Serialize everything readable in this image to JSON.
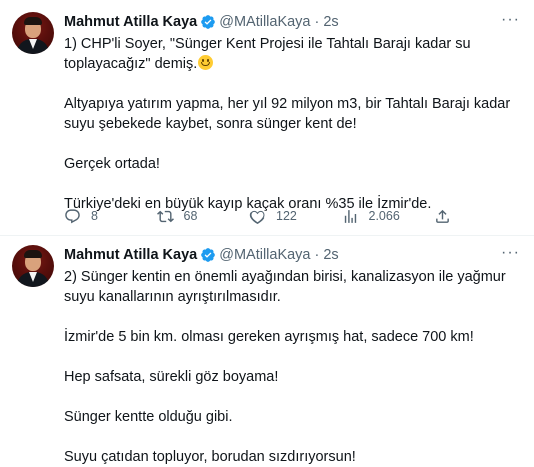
{
  "tweets": [
    {
      "author": "Mahmut Atilla Kaya",
      "handle": "@MAtillaKaya",
      "separator": "·",
      "time": "2s",
      "paragraphs": [
        "1) CHP'li Soyer, \"Sünger Kent Projesi ile Tahtalı Barajı kadar su toplayacağız\" demiş.",
        "Altyapıya yatırım yapma, her yıl 92 milyon m3, bir Tahtalı Barajı kadar suyu şebekede kaybet, sonra sünger kent de!",
        "Gerçek ortada!",
        "Türkiye'deki en büyük kayıp kaçak oranı %35 ile İzmir'de."
      ],
      "emoji": "grinning-face-emoji",
      "stats": {
        "replies": "8",
        "retweets": "68",
        "likes": "122",
        "views": "2.066"
      }
    },
    {
      "author": "Mahmut Atilla Kaya",
      "handle": "@MAtillaKaya",
      "separator": "·",
      "time": "2s",
      "paragraphs": [
        "2) Sünger kentin en önemli ayağından birisi, kanalizasyon ile yağmur suyu kanallarının ayrıştırılmasıdır.",
        "İzmir'de 5 bin km. olması gereken ayrışmış hat, sadece 700 km!",
        "Hep safsata, sürekli göz boyama!",
        "Sünger kentte olduğu gibi.",
        "Suyu çatıdan topluyor, borudan sızdırıyorsun!"
      ]
    }
  ],
  "more_label": "···",
  "colors": {
    "text": "#0f1419",
    "secondary": "#536471",
    "verified": "#1d9bf0",
    "divider": "#eff3f4"
  },
  "icons": [
    "reply-icon",
    "retweet-icon",
    "like-icon",
    "views-icon",
    "share-icon",
    "verified-badge-icon",
    "more-icon"
  ]
}
